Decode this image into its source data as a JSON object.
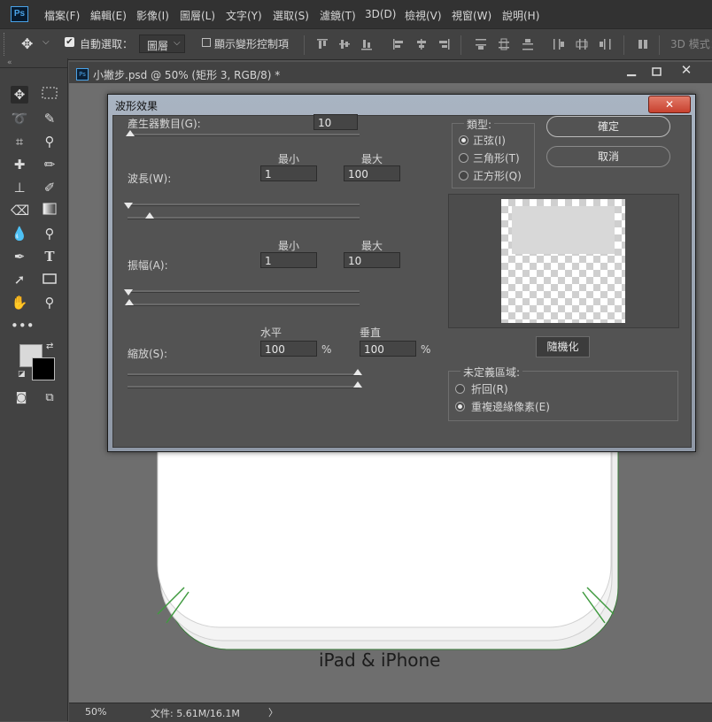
{
  "app": {
    "logo": "Ps",
    "menu": [
      "檔案(F)",
      "編輯(E)",
      "影像(I)",
      "圖層(L)",
      "文字(Y)",
      "選取(S)",
      "濾鏡(T)",
      "3D(D)",
      "檢視(V)",
      "視窗(W)",
      "說明(H)"
    ]
  },
  "options_bar": {
    "auto_select_label": "自動選取：",
    "auto_select_checked": true,
    "layer_select_value": "圖層",
    "show_transform_label": "顯示變形控制項",
    "show_transform_checked": false,
    "mode_3d_label": "3D 模式："
  },
  "document": {
    "tab_title": "小撇步.psd @ 50% (矩形 3, RGB/8) *",
    "canvas_caption": "iPad & iPhone",
    "zoom": "50%",
    "file_info": "文件: 5.61M/16.1M",
    "status_arrow": "〉"
  },
  "dialog": {
    "title": "波形效果",
    "generators_label": "產生器數目(G):",
    "generators_value": "10",
    "min_header": "最小",
    "max_header": "最大",
    "wavelength_label": "波長(W):",
    "wavelength_min": "1",
    "wavelength_max": "100",
    "amplitude_label": "振幅(A):",
    "amplitude_min": "1",
    "amplitude_max": "10",
    "scale_label": "縮放(S):",
    "scale_h_header": "水平",
    "scale_v_header": "垂直",
    "scale_h": "100",
    "scale_v": "100",
    "percent": "%",
    "type_group_label": "類型:",
    "type_options": [
      "正弦(I)",
      "三角形(T)",
      "正方形(Q)"
    ],
    "type_selected": "正弦(I)",
    "ok_button": "確定",
    "cancel_button": "取消",
    "randomize_button": "隨機化",
    "undefined_group_label": "未定義區域:",
    "undefined_options": [
      "折回(R)",
      "重複邊緣像素(E)"
    ],
    "undefined_selected": "重複邊緣像素(E)"
  },
  "colors": {
    "accent": "#4aa3e8",
    "close_button": "#c8412f",
    "panel": "#535353",
    "dark": "#323232"
  }
}
